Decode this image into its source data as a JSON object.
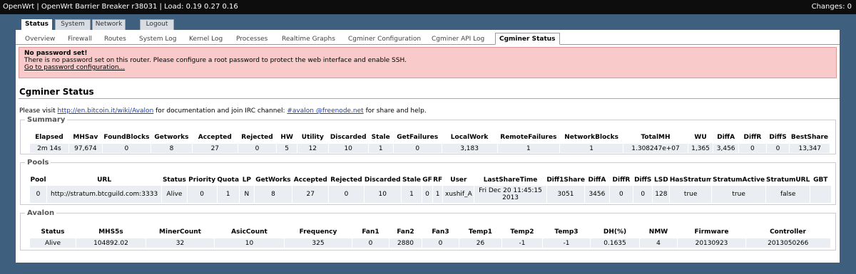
{
  "topbar": {
    "title": "OpenWrt | OpenWrt Barrier Breaker r38031 | Load: 0.19 0.27 0.16",
    "changes": "Changes: 0"
  },
  "maintabs": [
    "Status",
    "System",
    "Network",
    "Logout"
  ],
  "subtabs": [
    "Overview",
    "Firewall",
    "Routes",
    "System Log",
    "Kernel Log",
    "Processes",
    "Realtime Graphs",
    "Cgminer Configuration",
    "Cgminer API Log",
    "Cgminer Status"
  ],
  "alert": {
    "title": "No password set!",
    "text": "There is no password set on this router. Please configure a root password to protect the web interface and enable SSH.",
    "link": "Go to password configuration..."
  },
  "page": {
    "title": "Cgminer Status",
    "intro_pre": "Please visit ",
    "intro_link1": "http://en.bitcoin.it/wiki/Avalon",
    "intro_mid": " for documentation and join IRC channel: ",
    "intro_link2": "#avalon @freenode.net",
    "intro_post": " for share and help."
  },
  "summary": {
    "legend": "Summary",
    "headers": [
      "Elapsed",
      "MHSav",
      "FoundBlocks",
      "Getworks",
      "Accepted",
      "Rejected",
      "HW",
      "Utility",
      "Discarded",
      "Stale",
      "GetFailures",
      "LocalWork",
      "RemoteFailures",
      "NetworkBlocks",
      "TotalMH",
      "WU",
      "DiffA",
      "DiffR",
      "DiffS",
      "BestShare"
    ],
    "row": [
      "2m 14s",
      "97,674",
      "0",
      "8",
      "27",
      "0",
      "5",
      "12",
      "10",
      "1",
      "0",
      "3,183",
      "1",
      "1",
      "1.308247e+07",
      "1,365",
      "3,456",
      "0",
      "0",
      "13,347"
    ]
  },
  "pools": {
    "legend": "Pools",
    "headers": [
      "Pool",
      "URL",
      "Status",
      "Priority",
      "Quota",
      "LP",
      "GetWorks",
      "Accepted",
      "Rejected",
      "Discarded",
      "Stale",
      "GF",
      "RF",
      "User",
      "LastShareTime",
      "Diff1Shares",
      "DiffA",
      "DiffR",
      "DiffS",
      "LSD",
      "HasStratum",
      "StratumActive",
      "StratumURL",
      "GBT"
    ],
    "row": [
      "0",
      "http://stratum.btcguild.com:3333",
      "Alive",
      "0",
      "1",
      "N",
      "8",
      "27",
      "0",
      "10",
      "1",
      "0",
      "1",
      "xushif_A",
      "Fri Dec 20 11:45:15 2013",
      "3051",
      "3456",
      "0",
      "0",
      "128",
      "true",
      "true",
      "false",
      ""
    ]
  },
  "avalon": {
    "legend": "Avalon",
    "headers": [
      "Status",
      "MHS5s",
      "MinerCount",
      "AsicCount",
      "Frequency",
      "Fan1",
      "Fan2",
      "Fan3",
      "Temp1",
      "Temp2",
      "Temp3",
      "DH(%)",
      "NMW",
      "Firmware",
      "Controller"
    ],
    "row": [
      "Alive",
      "104892.02",
      "32",
      "10",
      "325",
      "0",
      "2880",
      "0",
      "26",
      "-1",
      "-1",
      "0.1635",
      "4",
      "20130923",
      "2013050266"
    ]
  }
}
